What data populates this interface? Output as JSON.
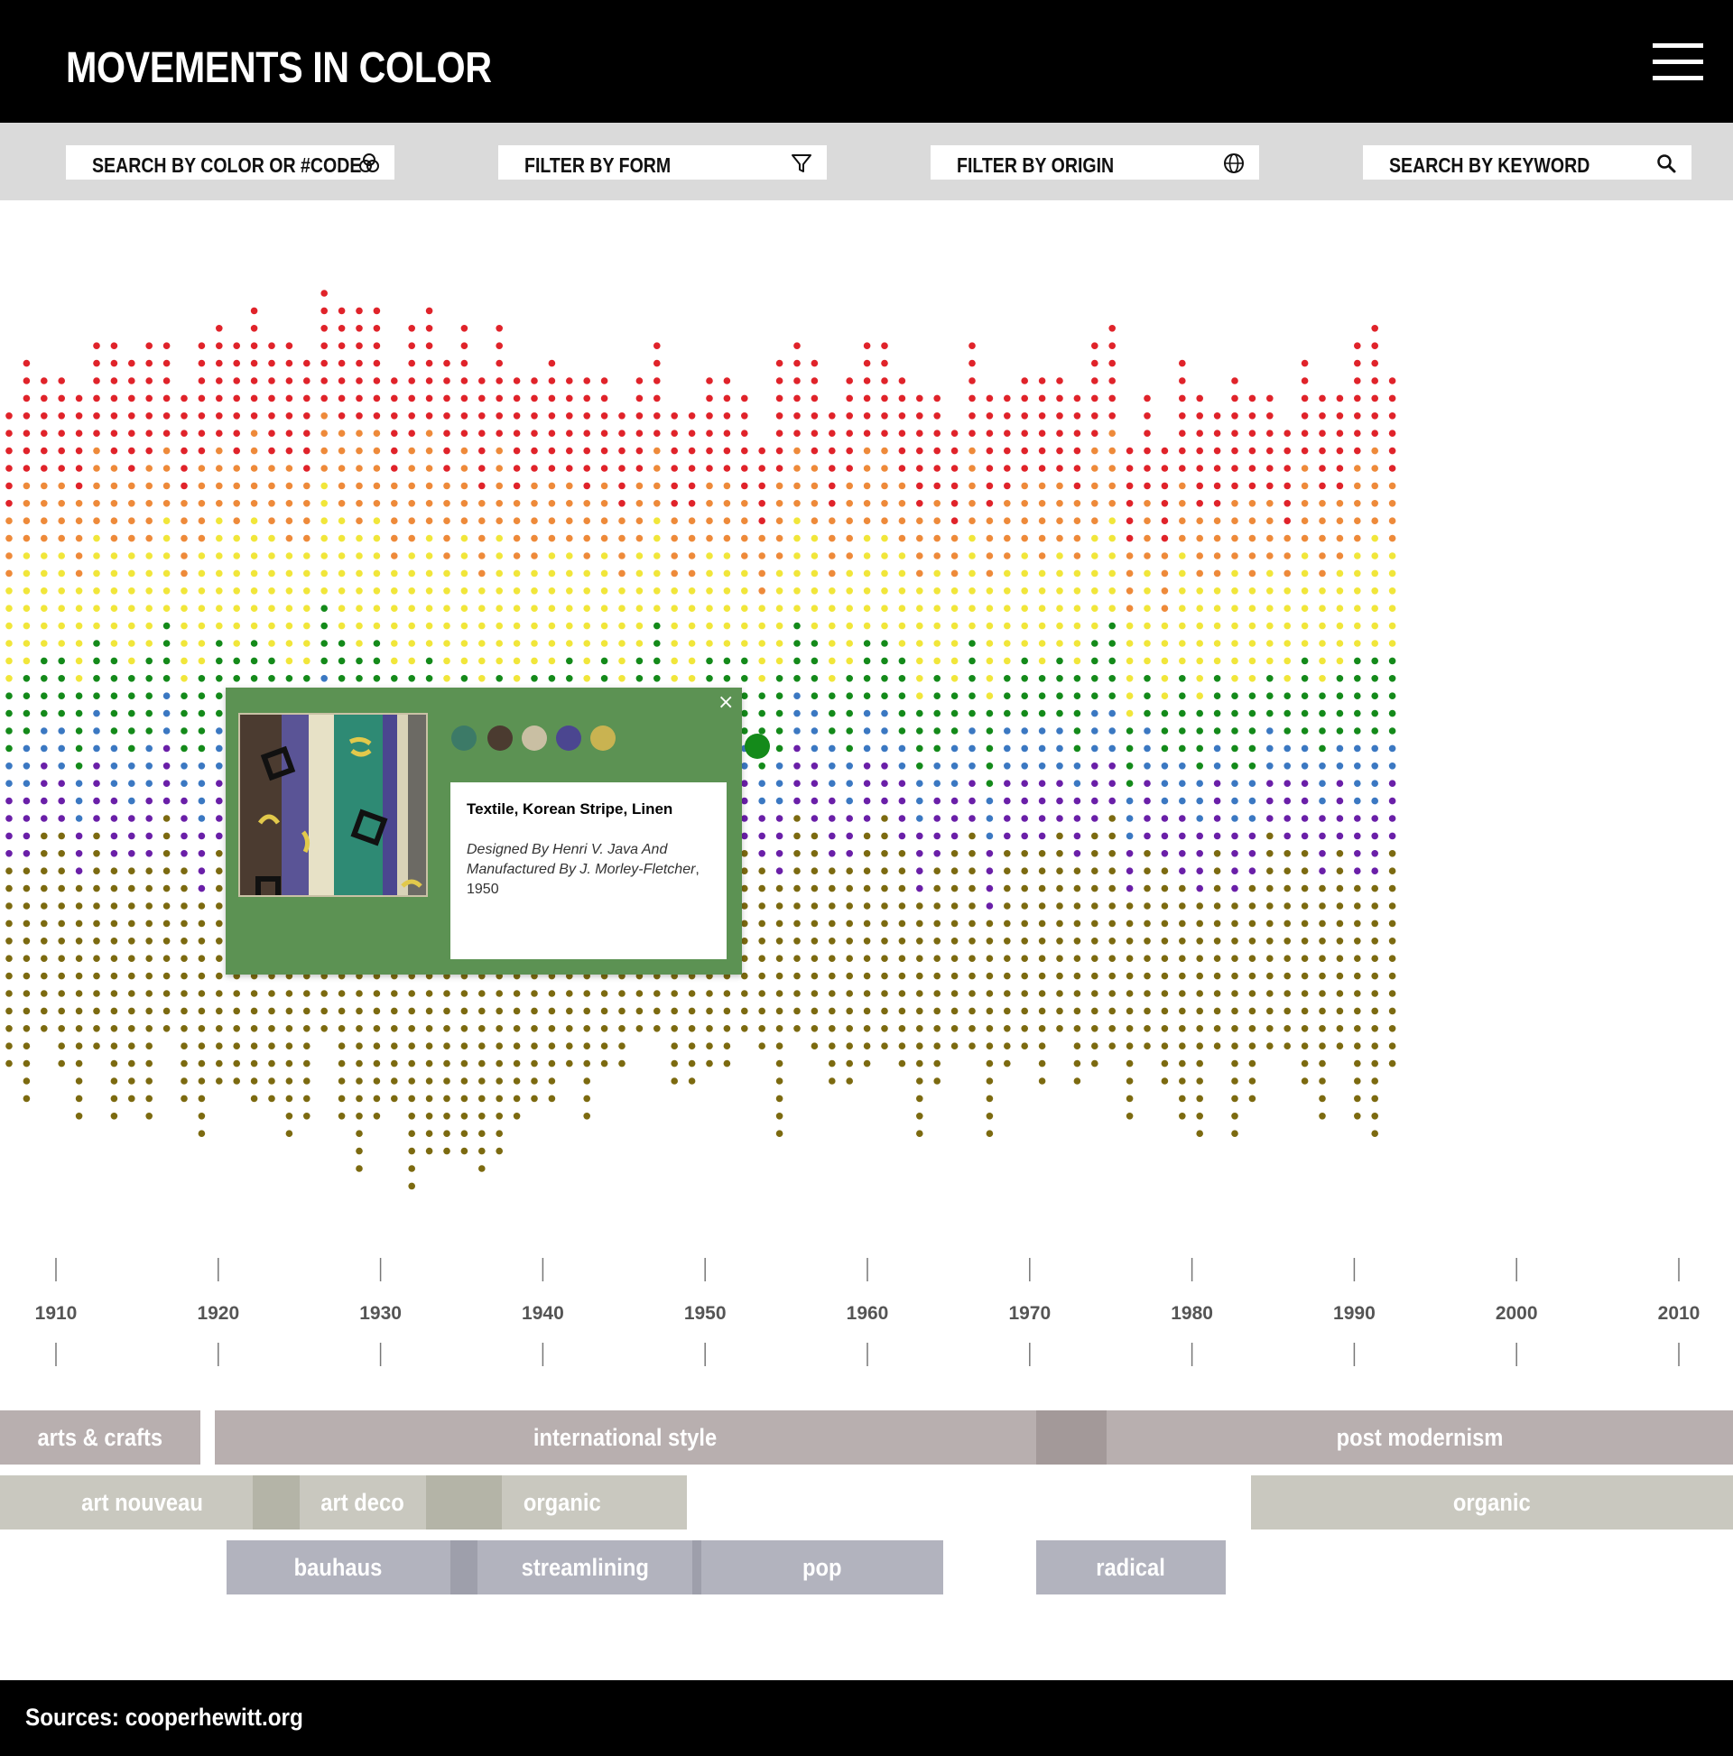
{
  "header": {
    "title": "MOVEMENTS IN COLOR"
  },
  "toolbar": {
    "search_color": "SEARCH BY COLOR OR #CODE",
    "filter_form": "FILTER BY FORM",
    "filter_origin": "FILTER BY ORIGIN",
    "search_keyword": "SEARCH BY KEYWORD"
  },
  "colors": {
    "red": "#e0232a",
    "orange": "#ee8a3a",
    "yellow": "#f1e63a",
    "green": "#148a1a",
    "blue": "#3b78c2",
    "purple": "#6a1fa8",
    "olive": "#7c6a10",
    "popup_bg": "#5c9253",
    "movement_row1": "#b8afaf",
    "movement_row2": "#c9c8bf",
    "movement_row3": "#b2b3be"
  },
  "chart_data": {
    "type": "scatter",
    "x_axis": {
      "ticks": [
        "1910",
        "1920",
        "1930",
        "1940",
        "1950",
        "1960",
        "1970",
        "1980",
        "1990",
        "2000",
        "2010"
      ]
    },
    "color_bands_top_to_bottom": [
      "red",
      "orange",
      "yellow",
      "green",
      "blue",
      "purple",
      "olive"
    ]
  },
  "popup": {
    "title": "Textile, Korean Stripe, Linen",
    "credit": "Designed By Henri V. Java And Manufactured By J. Morley-Fletcher",
    "year": ", 1950",
    "close": "×",
    "swatches": [
      "#3c7a67",
      "#4b3b30",
      "#c9bfa3",
      "#4b4690",
      "#c9b351"
    ]
  },
  "movements": {
    "arts_crafts": "arts & crafts",
    "international_style": "international style",
    "post_modernism": "post modernism",
    "art_nouveau": "art nouveau",
    "art_deco": "art deco",
    "organic_1": "organic",
    "organic_2": "organic",
    "bauhaus": "bauhaus",
    "streamlining": "streamlining",
    "pop": "pop",
    "radical": "radical"
  },
  "footer": {
    "source": "Sources: cooperhewitt.org"
  }
}
